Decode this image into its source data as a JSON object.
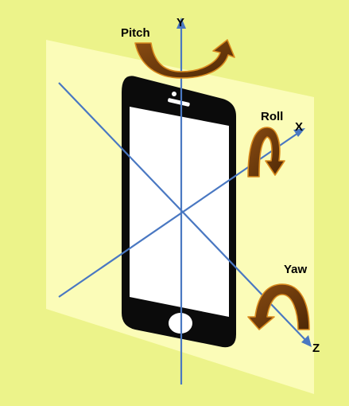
{
  "colors": {
    "background": "#ecf38a",
    "plane": "#fbfcb8",
    "axis": "#4a78c2",
    "phone_body": "#0b0b0b",
    "screen": "#ffffff",
    "arrow_fill": "#6b3a0c",
    "arrow_outline": "#d98a1e"
  },
  "axes": {
    "y_label": "Y",
    "x_label": "X",
    "z_label": "Z"
  },
  "rotations": {
    "pitch_label": "Pitch",
    "roll_label": "Roll",
    "yaw_label": "Yaw"
  },
  "icons": {
    "pitch_arrow": "curved-arrow-icon",
    "roll_arrow": "curved-arrow-icon",
    "yaw_arrow": "curved-arrow-icon"
  }
}
